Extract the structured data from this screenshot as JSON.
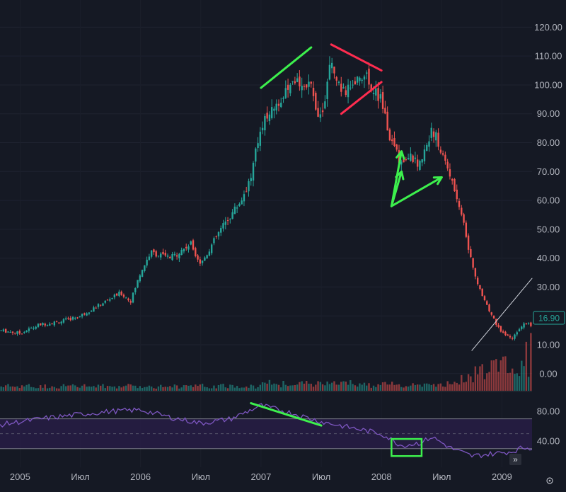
{
  "chart_data": {
    "type": "candlestick",
    "title": "",
    "price_axis": {
      "ticks": [
        "120.00",
        "110.00",
        "100.00",
        "90.00",
        "80.00",
        "70.00",
        "60.00",
        "50.00",
        "40.00",
        "30.00",
        "20.00",
        "10.00",
        "0.00"
      ],
      "ylim": [
        -3,
        125
      ]
    },
    "rsi_axis": {
      "ticks": [
        "80.00",
        "40.00"
      ],
      "band": [
        30,
        70
      ],
      "ylim": [
        5,
        102
      ]
    },
    "x_axis": {
      "labels": [
        "2005",
        "Июл",
        "2006",
        "Июл",
        "2007",
        "Июл",
        "2008",
        "Июл",
        "2009"
      ],
      "start": "2004-11",
      "end": "2009-04"
    },
    "last_price": "16.90",
    "close_series": [
      {
        "date": "2004-11",
        "close": 15
      },
      {
        "date": "2005-01",
        "close": 14
      },
      {
        "date": "2005-03",
        "close": 17
      },
      {
        "date": "2005-05",
        "close": 18
      },
      {
        "date": "2005-07",
        "close": 20
      },
      {
        "date": "2005-09",
        "close": 24
      },
      {
        "date": "2005-11",
        "close": 28
      },
      {
        "date": "2005-12",
        "close": 25
      },
      {
        "date": "2006-01",
        "close": 35
      },
      {
        "date": "2006-02",
        "close": 42
      },
      {
        "date": "2006-04",
        "close": 40
      },
      {
        "date": "2006-06",
        "close": 45
      },
      {
        "date": "2006-07",
        "close": 38
      },
      {
        "date": "2006-09",
        "close": 50
      },
      {
        "date": "2006-11",
        "close": 60
      },
      {
        "date": "2006-12",
        "close": 68
      },
      {
        "date": "2007-01",
        "close": 86
      },
      {
        "date": "2007-03",
        "close": 95
      },
      {
        "date": "2007-05",
        "close": 102
      },
      {
        "date": "2007-06",
        "close": 98
      },
      {
        "date": "2007-07",
        "close": 88
      },
      {
        "date": "2007-08",
        "close": 108
      },
      {
        "date": "2007-09",
        "close": 96
      },
      {
        "date": "2007-11",
        "close": 104
      },
      {
        "date": "2007-12",
        "close": 100
      },
      {
        "date": "2008-01",
        "close": 94
      },
      {
        "date": "2008-02",
        "close": 80
      },
      {
        "date": "2008-03",
        "close": 73
      },
      {
        "date": "2008-04",
        "close": 75
      },
      {
        "date": "2008-05",
        "close": 72
      },
      {
        "date": "2008-06",
        "close": 86
      },
      {
        "date": "2008-07",
        "close": 76
      },
      {
        "date": "2008-08",
        "close": 68
      },
      {
        "date": "2008-09",
        "close": 55
      },
      {
        "date": "2008-10",
        "close": 38
      },
      {
        "date": "2008-11",
        "close": 27
      },
      {
        "date": "2008-12",
        "close": 20
      },
      {
        "date": "2009-01",
        "close": 14
      },
      {
        "date": "2009-02",
        "close": 12
      },
      {
        "date": "2009-03",
        "close": 17
      }
    ],
    "rsi_series": [
      {
        "date": "2004-11",
        "value": 62
      },
      {
        "date": "2005-03",
        "value": 70
      },
      {
        "date": "2005-07",
        "value": 76
      },
      {
        "date": "2005-10",
        "value": 80
      },
      {
        "date": "2006-01",
        "value": 82
      },
      {
        "date": "2006-04",
        "value": 72
      },
      {
        "date": "2006-07",
        "value": 64
      },
      {
        "date": "2006-10",
        "value": 70
      },
      {
        "date": "2007-01",
        "value": 88
      },
      {
        "date": "2007-04",
        "value": 78
      },
      {
        "date": "2007-07",
        "value": 66
      },
      {
        "date": "2007-10",
        "value": 58
      },
      {
        "date": "2008-01",
        "value": 50
      },
      {
        "date": "2008-03",
        "value": 34
      },
      {
        "date": "2008-05",
        "value": 38
      },
      {
        "date": "2008-06",
        "value": 46
      },
      {
        "date": "2008-08",
        "value": 30
      },
      {
        "date": "2008-10",
        "value": 20
      },
      {
        "date": "2008-12",
        "value": 23
      },
      {
        "date": "2009-02",
        "value": 26
      },
      {
        "date": "2009-03",
        "value": 31
      }
    ],
    "colors": {
      "background": "#151924",
      "up": "#26a69a",
      "down": "#ef5350",
      "rsi": "#7e57c2",
      "rsi_band": "#2a1e4a",
      "annotation_green": "#3df04d",
      "annotation_red": "#ff2c4f",
      "trendline_white": "#d1d4dc"
    },
    "annotations": [
      {
        "type": "line",
        "color": "green",
        "pane": "price",
        "from": {
          "date": "2007-01",
          "price": 99
        },
        "to": {
          "date": "2007-06",
          "price": 113
        }
      },
      {
        "type": "line",
        "color": "red",
        "pane": "price",
        "from": {
          "date": "2007-08",
          "price": 114
        },
        "to": {
          "date": "2008-01",
          "price": 105
        }
      },
      {
        "type": "line",
        "color": "red",
        "pane": "price",
        "from": {
          "date": "2007-09",
          "price": 90
        },
        "to": {
          "date": "2008-01",
          "price": 101
        }
      },
      {
        "type": "arrow",
        "color": "green",
        "pane": "price",
        "from": {
          "date": "2008-02",
          "price": 58
        },
        "to": {
          "date": "2008-03",
          "price": 77
        }
      },
      {
        "type": "arrow",
        "color": "green",
        "pane": "price",
        "from": {
          "date": "2008-02",
          "price": 58
        },
        "to": {
          "date": "2008-03",
          "price": 70
        }
      },
      {
        "type": "arrow",
        "color": "green",
        "pane": "price",
        "from": {
          "date": "2008-02",
          "price": 58
        },
        "to": {
          "date": "2008-07",
          "price": 68
        }
      },
      {
        "type": "line",
        "color": "white",
        "pane": "price",
        "from": {
          "date": "2008-10",
          "price": 8
        },
        "to": {
          "date": "2009-04",
          "price": 33
        }
      },
      {
        "type": "line",
        "color": "green",
        "pane": "rsi",
        "from": {
          "date": "2006-12",
          "value": 91
        },
        "to": {
          "date": "2007-07",
          "value": 61
        }
      },
      {
        "type": "rect",
        "color": "green",
        "pane": "rsi",
        "from": {
          "date": "2008-02",
          "value": 43
        },
        "to": {
          "date": "2008-05",
          "value": 20
        }
      }
    ]
  },
  "ui": {
    "scroll_button_label": "»",
    "settings_icon": "gear-icon"
  }
}
